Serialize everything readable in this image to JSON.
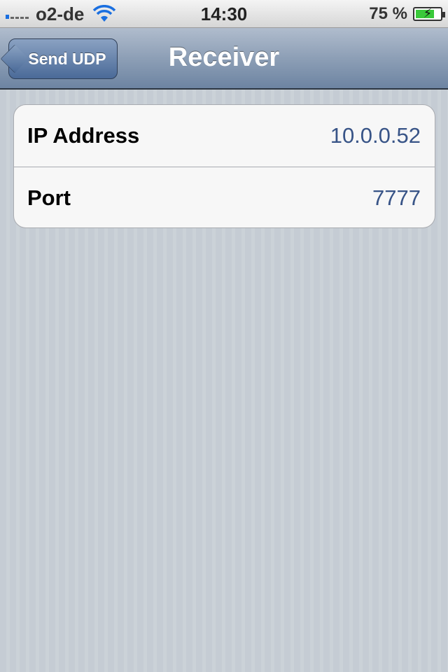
{
  "status_bar": {
    "carrier": "o2-de",
    "time": "14:30",
    "battery_percent": "75 %",
    "battery_level": 0.75,
    "signal_icon": "signal-bars-icon",
    "wifi_icon": "wifi-icon",
    "battery_icon": "battery-charging-icon"
  },
  "navbar": {
    "back_label": "Send UDP",
    "title": "Receiver"
  },
  "settings": {
    "rows": [
      {
        "label": "IP Address",
        "value": "10.0.0.52"
      },
      {
        "label": "Port",
        "value": "7777"
      }
    ]
  },
  "colors": {
    "value_text": "#385487",
    "nav_accent": "#6d84a2"
  }
}
